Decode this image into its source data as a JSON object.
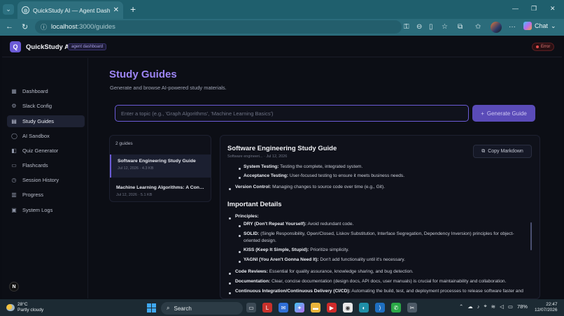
{
  "browser": {
    "tab_title": "QuickStudy AI — Agent Dashboard",
    "tab_close": "✕",
    "new_tab": "+",
    "url_host": "localhost",
    "url_path": ":3000/guides",
    "chat_label": "Chat"
  },
  "app": {
    "logo_letter": "Q",
    "name": "QuickStudy AI",
    "badge": "agent dashboard",
    "error_badge": "Error"
  },
  "sidebar": {
    "items": [
      {
        "label": "Dashboard",
        "icon": "grid-icon",
        "glyph": "▦"
      },
      {
        "label": "Slack Config",
        "icon": "gear-icon",
        "glyph": "⚙"
      },
      {
        "label": "Study Guides",
        "icon": "book-icon",
        "glyph": "▤"
      },
      {
        "label": "AI Sandbox",
        "icon": "chat-bubble-icon",
        "glyph": "◯"
      },
      {
        "label": "Quiz Generator",
        "icon": "quiz-icon",
        "glyph": "◧"
      },
      {
        "label": "Flashcards",
        "icon": "flashcard-icon",
        "glyph": "▭"
      },
      {
        "label": "Session History",
        "icon": "history-icon",
        "glyph": "◷"
      },
      {
        "label": "Progress",
        "icon": "bar-chart-icon",
        "glyph": "▥"
      },
      {
        "label": "System Logs",
        "icon": "terminal-icon",
        "glyph": "▣"
      }
    ],
    "active_index": 2,
    "footer_logo": "N"
  },
  "main": {
    "title": "Study Guides",
    "subtitle": "Generate and browse AI-powered study materials.",
    "topic_placeholder": "Enter a topic (e.g., 'Graph Algorithms', 'Machine Learning Basics')",
    "generate_label": "Generate Guide",
    "generate_glyph": "+"
  },
  "guides": {
    "count_label": "2 guides",
    "items": [
      {
        "title": "Software Engineering Study Guide",
        "meta": "Jul 12, 2026 · 4.3 KB"
      },
      {
        "title": "Machine Learning Algorithms: A Concis...",
        "meta": "Jul 12, 2026 · 5.1 KB"
      }
    ]
  },
  "doc": {
    "title": "Software Engineering Study Guide",
    "meta": "Software engineeri... · Jul 12, 2026",
    "copy_label": "Copy Markdown",
    "heading": "Important Details",
    "lines": {
      "system_testing_b": "System Testing:",
      "system_testing_t": " Testing the complete, integrated system.",
      "acceptance_b": "Acceptance Testing:",
      "acceptance_t": " User-focused testing to ensure it meets business needs.",
      "vc_b": "Version Control:",
      "vc_t": " Managing changes to source code over time (e.g., Git).",
      "principles_b": "Principles:",
      "dry_b": "DRY (Don't Repeat Yourself):",
      "dry_t": " Avoid redundant code.",
      "solid_b": "SOLID:",
      "solid_t": " (Single Responsibility, Open/Closed, Liskov Substitution, Interface Segregation, Dependency Inversion) principles for object-",
      "solid_t2": "oriented design.",
      "kiss_b": "KISS (Keep It Simple, Stupid):",
      "kiss_t": " Prioritize simplicity.",
      "yagni_b": "YAGNI (You Aren't Gonna Need It):",
      "yagni_t": " Don't add functionality until it's necessary.",
      "cr_b": "Code Reviews:",
      "cr_t": " Essential for quality assurance, knowledge sharing, and bug detection.",
      "doc_b": "Documentation:",
      "doc_t": " Clear, concise documentation (design docs, API docs, user manuals) is crucial for maintainability and collaboration.",
      "ci_b": "Continuous Integration/Continuous Delivery (CI/CD):",
      "ci_t": " Automating the build, test, and deployment processes to release software faster and"
    }
  },
  "taskbar": {
    "temp": "28°C",
    "weather": "Partly cloudy",
    "search": "Search",
    "battery": "78%",
    "time": "22:47",
    "date": "12/07/2026"
  }
}
